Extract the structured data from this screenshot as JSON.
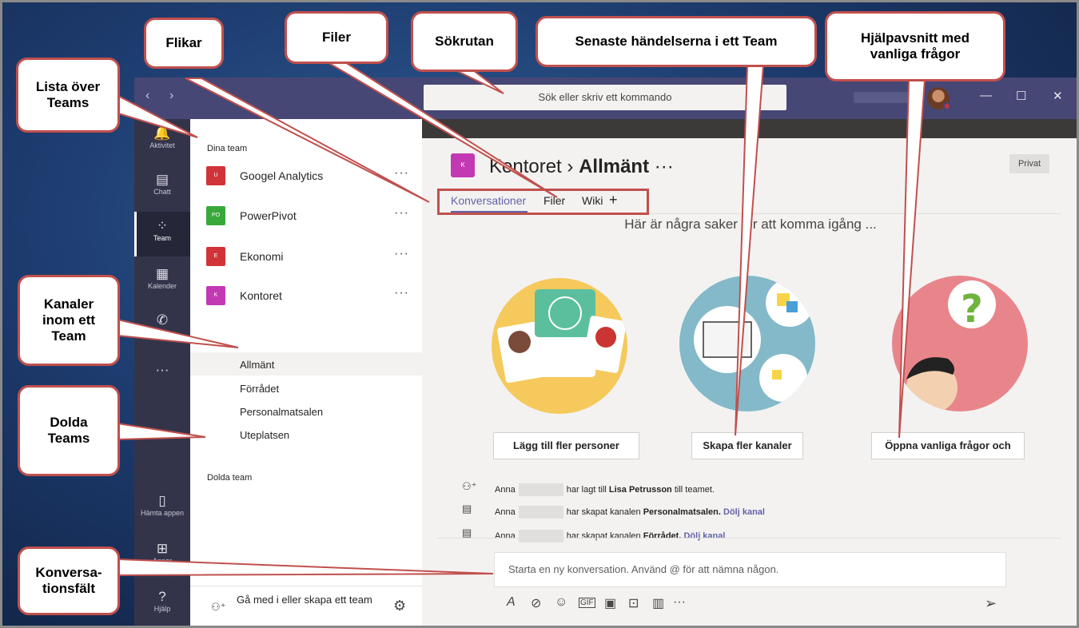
{
  "window": {
    "search_placeholder": "Sök eller skriv ett kommando",
    "controls": [
      "—",
      "☐",
      "✕"
    ],
    "nav_back": "‹",
    "nav_forward": "›"
  },
  "rail": [
    {
      "label": "Aktivitet",
      "icon": "bell-icon",
      "glyph": "🔔"
    },
    {
      "label": "Chatt",
      "icon": "chat-icon",
      "glyph": "▤"
    },
    {
      "label": "Team",
      "icon": "teams-icon",
      "glyph": "⁘"
    },
    {
      "label": "Kalender",
      "icon": "calendar-icon",
      "glyph": "▦"
    },
    {
      "label": "",
      "icon": "phone-icon",
      "glyph": "✆"
    },
    {
      "label": "",
      "icon": "more-icon",
      "glyph": "···"
    },
    {
      "label": "Hämta appen",
      "icon": "mobile-icon",
      "glyph": "▯"
    },
    {
      "label": "Appar",
      "icon": "apps-icon",
      "glyph": "⊞"
    },
    {
      "label": "Hjälp",
      "icon": "help-icon",
      "glyph": "?"
    }
  ],
  "panel": {
    "your_teams_label": "Dina team",
    "teams": [
      {
        "name": "Googel Analytics",
        "initials": "U",
        "color": "#d13438"
      },
      {
        "name": "PowerPivot",
        "initials": "PO",
        "color": "#38a83a"
      },
      {
        "name": "Ekonomi",
        "initials": "E",
        "color": "#d13438"
      },
      {
        "name": "Kontoret",
        "initials": "K",
        "color": "#c239b3"
      }
    ],
    "more": "···",
    "channels": [
      "Allmänt",
      "Förrådet",
      "Personalmatsalen",
      "Uteplatsen"
    ],
    "hidden_label": "Dolda team",
    "join_label": "Gå med i eller skapa ett team"
  },
  "channel": {
    "tile": "K",
    "team": "Kontoret",
    "separator": "›",
    "name": "Allmänt",
    "more": "···",
    "privacy": "Privat",
    "tabs": [
      "Konversationer",
      "Filer",
      "Wiki",
      "+"
    ],
    "hero": "Här är några saker för att komma igång ...",
    "cards": [
      {
        "button": "Lägg till fler personer"
      },
      {
        "button": "Skapa fler kanaler"
      },
      {
        "button": "Öppna vanliga frågor och"
      }
    ],
    "activity": [
      {
        "who": "Anna",
        "text": "har lagt till",
        "bold": "Lisa Petrusson",
        "tail": "till teamet.",
        "link": ""
      },
      {
        "who": "Anna",
        "text": "har skapat kanalen",
        "bold": "Personalmatsalen.",
        "tail": "",
        "link": "Dölj kanal"
      },
      {
        "who": "Anna",
        "text": "har skapat kanalen",
        "bold": "Förrådet.",
        "tail": "",
        "link": "Dölj kanal"
      }
    ],
    "compose_placeholder": "Starta en ny konversation. Använd @ för att nämna någon.",
    "toolbar": [
      "A",
      "⊘",
      "☺",
      "GIF",
      "▣",
      "⊡",
      "▥",
      "···"
    ],
    "send": "➢"
  },
  "callouts": {
    "flikar": "Flikar",
    "filer": "Filer",
    "sokrutan": "Sökrutan",
    "senaste": "Senaste händelserna i ett Team",
    "hjalp": "Hjälpavsnitt med vanliga frågor",
    "lista": "Lista över Teams",
    "kanaler": "Kanaler inom ett Team",
    "dolda": "Dolda Teams",
    "konv": "Konversa-tionsfält"
  }
}
